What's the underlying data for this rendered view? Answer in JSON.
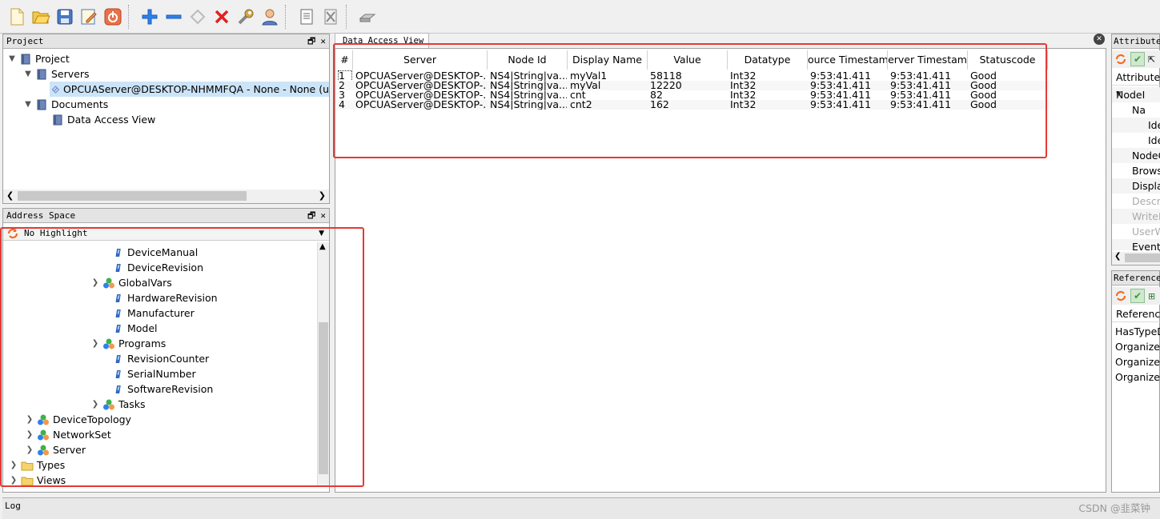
{
  "toolbar": {
    "buttons": [
      "new-icon",
      "open-icon",
      "save-icon",
      "edit-icon",
      "power-icon",
      "add-icon",
      "remove-icon",
      "refresh-icon",
      "delete-icon",
      "wrench-icon",
      "user-icon",
      "document-icon",
      "clear-icon",
      "device-icon"
    ]
  },
  "project": {
    "title": "Project",
    "nodes": {
      "project": "Project",
      "servers": "Servers",
      "server_item": "OPCUAServer@DESKTOP-NHMMFQA - None - None (u",
      "documents": "Documents",
      "dav": "Data Access View"
    }
  },
  "address": {
    "title": "Address Space",
    "filter": "No Highlight",
    "items": [
      {
        "label": "DeviceManual",
        "kind": "variable"
      },
      {
        "label": "DeviceRevision",
        "kind": "variable"
      },
      {
        "label": "GlobalVars",
        "kind": "object"
      },
      {
        "label": "HardwareRevision",
        "kind": "variable"
      },
      {
        "label": "Manufacturer",
        "kind": "variable"
      },
      {
        "label": "Model",
        "kind": "variable"
      },
      {
        "label": "Programs",
        "kind": "object"
      },
      {
        "label": "RevisionCounter",
        "kind": "variable"
      },
      {
        "label": "SerialNumber",
        "kind": "variable"
      },
      {
        "label": "SoftwareRevision",
        "kind": "variable"
      },
      {
        "label": "Tasks",
        "kind": "object"
      },
      {
        "label": "DeviceTopology",
        "kind": "object"
      },
      {
        "label": "NetworkSet",
        "kind": "object"
      },
      {
        "label": "Server",
        "kind": "object"
      },
      {
        "label": "Types",
        "kind": "folder"
      },
      {
        "label": "Views",
        "kind": "folder"
      }
    ]
  },
  "dav": {
    "tab": "Data Access View",
    "columns": [
      "#",
      "Server",
      "Node Id",
      "Display Name",
      "Value",
      "Datatype",
      "ource Timestam",
      "erver Timestam",
      "Statuscode"
    ],
    "rows": [
      [
        "1",
        "OPCUAServer@DESKTOP-...",
        "NS4|String|va...",
        "myVal1",
        "58118",
        "Int32",
        "9:53:41.411",
        "9:53:41.411",
        "Good"
      ],
      [
        "2",
        "OPCUAServer@DESKTOP-...",
        "NS4|String|va...",
        "myVal",
        "12220",
        "Int32",
        "9:53:41.411",
        "9:53:41.411",
        "Good"
      ],
      [
        "3",
        "OPCUAServer@DESKTOP-...",
        "NS4|String|va...",
        "cnt",
        "82",
        "Int32",
        "9:53:41.411",
        "9:53:41.411",
        "Good"
      ],
      [
        "4",
        "OPCUAServer@DESKTOP-...",
        "NS4|String|va...",
        "cnt2",
        "162",
        "Int32",
        "9:53:41.411",
        "9:53:41.411",
        "Good"
      ]
    ]
  },
  "attributes": {
    "title": "Attributes",
    "header": "Attribute",
    "rows": [
      {
        "label": "NodeI",
        "muted": false
      },
      {
        "label": "Na",
        "muted": false
      },
      {
        "label": "Ide",
        "muted": false
      },
      {
        "label": "Ide",
        "muted": false
      },
      {
        "label": "NodeC",
        "muted": false
      },
      {
        "label": "Brows",
        "muted": false
      },
      {
        "label": "Displa",
        "muted": false
      },
      {
        "label": "Descri",
        "muted": true
      },
      {
        "label": "WriteN",
        "muted": true
      },
      {
        "label": "UserW",
        "muted": true
      },
      {
        "label": "EventN",
        "muted": false
      }
    ]
  },
  "references": {
    "title": "References",
    "header": "Reference",
    "rows": [
      "HasTypeD",
      "Organizes",
      "Organizes",
      "Organizes"
    ]
  },
  "log": {
    "title": "Log"
  },
  "watermark": "CSDN @韭菜钟",
  "colors": {
    "highlight": "#e53935",
    "selection": "#cce4f7"
  }
}
